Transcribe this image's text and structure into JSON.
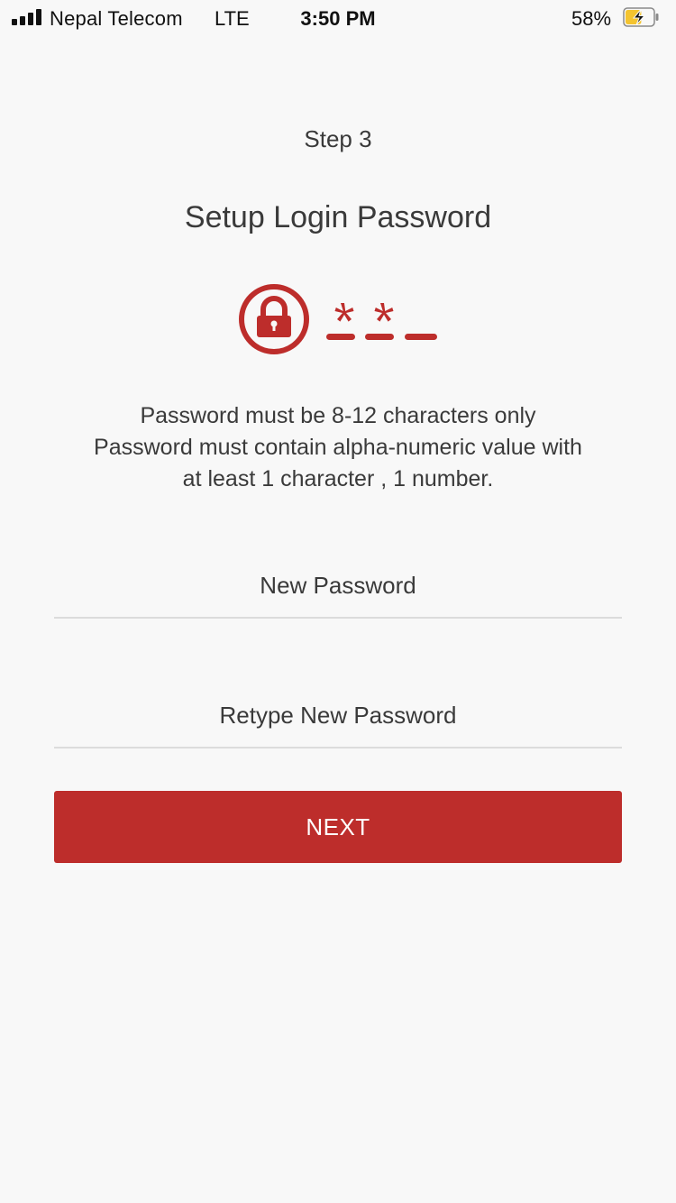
{
  "status_bar": {
    "carrier": "Nepal Telecom",
    "network": "LTE",
    "time": "3:50 PM",
    "battery_percent": "58%",
    "battery_level": 0.58,
    "battery_charging": true
  },
  "page": {
    "step": "Step 3",
    "title": "Setup Login Password",
    "illustration_icon": "password-lock-icon",
    "rules": [
      "Password must be 8-12 characters only",
      "Password must contain alpha-numeric value with",
      "at least 1 character , 1 number."
    ]
  },
  "form": {
    "new_password_placeholder": "New Password",
    "retype_password_placeholder": "Retype New Password",
    "next_label": "NEXT"
  },
  "colors": {
    "accent": "#bd2d2b",
    "text": "#3a3a3a",
    "background": "#f8f8f8",
    "divider": "#dcdcdc",
    "battery_charging": "#f4c430"
  }
}
